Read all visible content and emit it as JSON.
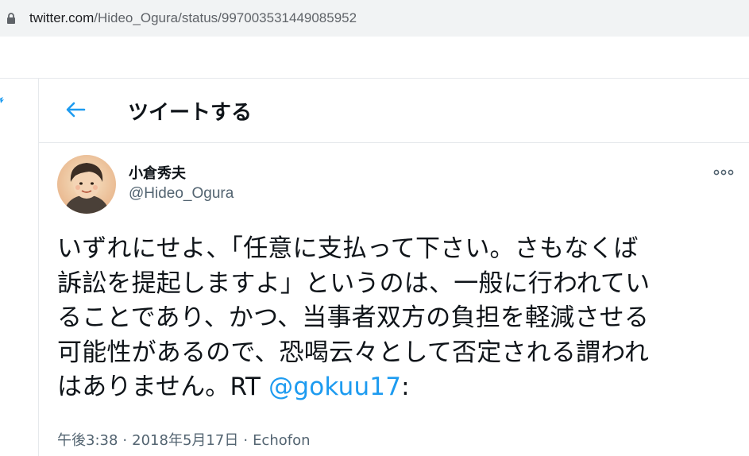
{
  "browser": {
    "url_host": "twitter.com",
    "url_path": "/Hideo_Ogura/status/997003531449085952"
  },
  "header": {
    "title": "ツイートする"
  },
  "tweet": {
    "display_name": "小倉秀夫",
    "handle": "@Hideo_Ogura",
    "text_lines": [
      "いずれにせよ、「任意に支払って下さい。さもなくば",
      "訴訟を提起しますよ」というのは、一般に行われてい",
      "ることであり、かつ、当事者双方の負担を軽減させる",
      "可能性があるので、恐喝云々として否定される謂われ"
    ],
    "last_line_prefix": "はありません。RT ",
    "mention": "@gokuu17",
    "last_line_suffix": ":",
    "time": "午後3:38",
    "date": "2018年5月17日",
    "source": "Echofon"
  },
  "colors": {
    "accent": "#1d9bf0",
    "text_primary": "#0f1419",
    "text_secondary": "#536471",
    "urlbar_bg": "#f1f3f4"
  },
  "icons": {
    "lock": "lock-icon",
    "back": "arrow-left-icon",
    "more": "more-horizontal-icon"
  }
}
